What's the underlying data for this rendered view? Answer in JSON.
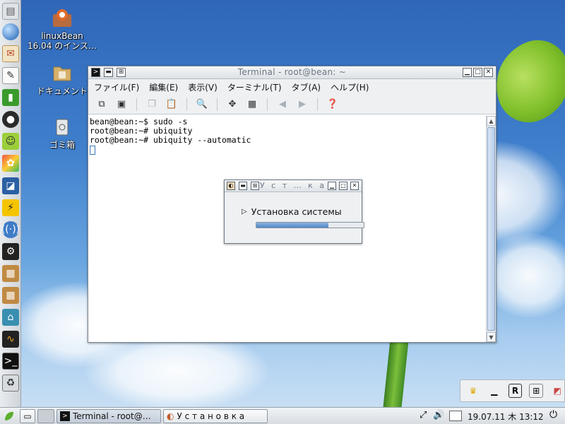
{
  "desktop": {
    "icons": [
      {
        "label_line1": "linuxBean",
        "label_line2": "16.04 のインス…",
        "icon": "installer-icon"
      },
      {
        "label_line1": "ドキュメント",
        "icon": "folder-icon"
      },
      {
        "label_line1": "ゴミ箱",
        "icon": "trash-icon"
      }
    ]
  },
  "dock": {
    "items": [
      "files-icon",
      "globe-icon",
      "mail-icon",
      "text-editor-icon",
      "green-app-icon",
      "webcam-icon",
      "android-icon",
      "paint-icon",
      "image-viewer-icon",
      "lightning-icon",
      "wireless-icon",
      "settings-icon",
      "package-icon",
      "package-update-icon",
      "network-icon",
      "system-monitor-icon",
      "terminal-icon",
      "trash-icon"
    ]
  },
  "terminal": {
    "title": "Terminal - root@bean: ~",
    "menu": [
      "ファイル(F)",
      "編集(E)",
      "表示(V)",
      "ターミナル(T)",
      "タブ(A)",
      "ヘルプ(H)"
    ],
    "lines": [
      "bean@bean:~$ sudo -s",
      "root@bean:~# ubiquity",
      "root@bean:~# ubiquity --automatic"
    ]
  },
  "installer": {
    "title": "У с т … к а",
    "status": "Установка системы",
    "progress": 0.67
  },
  "taskbar": {
    "tasks": [
      {
        "label": "Terminal - root@…",
        "icon": "terminal-icon",
        "active": true
      },
      {
        "label": "У с т а н о в к а",
        "icon": "installer-icon",
        "active": false
      }
    ],
    "clock": "19.07.11 木 13:12"
  },
  "colors": {
    "accent": "#4f87c9",
    "dock_bg": "#dde1e5"
  }
}
